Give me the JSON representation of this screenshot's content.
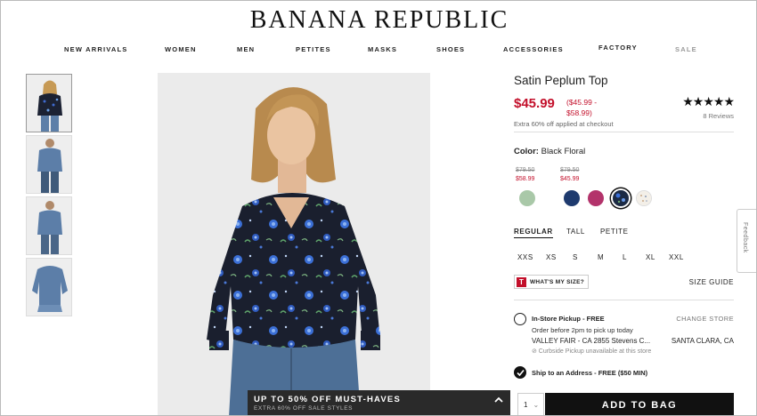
{
  "brand": {
    "logo": "BANANA REPUBLIC"
  },
  "nav": {
    "items": [
      "NEW ARRIVALS",
      "WOMEN",
      "MEN",
      "PETITES",
      "MASKS",
      "SHOES",
      "ACCESSORIES",
      "FACTORY",
      "SALE"
    ]
  },
  "promo": {
    "title": "UP TO 50% OFF MUST-HAVES",
    "subtitle": "EXTRA 60% OFF SALE STYLES"
  },
  "product": {
    "title": "Satin Peplum Top",
    "price": "$45.99",
    "range_line1": "($45.99 -",
    "range_line2": "$58.99)",
    "extra_note": "Extra 60% off applied at checkout",
    "stars": "★★★★★",
    "reviews": "8 Reviews",
    "color_label": "Color:",
    "color_value": "Black Floral",
    "swatch_prices": [
      {
        "was": "$79.50",
        "now": "$58.99"
      },
      {
        "was": "$79.50",
        "now": "$45.99"
      }
    ],
    "swatch_colors": [
      "#a9c8a8",
      "#1e3a6e",
      "#b3336b",
      "#1b2a44",
      "#f1ece6"
    ],
    "selected_swatch": 3
  },
  "fits": {
    "items": [
      "REGULAR",
      "TALL",
      "PETITE"
    ],
    "selected": 0
  },
  "sizes": {
    "items": [
      "XXS",
      "XS",
      "S",
      "M",
      "L",
      "XL",
      "XXL"
    ]
  },
  "size_tools": {
    "whats_my_size": "WHAT'S MY SIZE?",
    "whats_my_size_badge": "T",
    "size_guide": "SIZE GUIDE"
  },
  "fulfillment": {
    "pickup_label": "In-Store Pickup - FREE",
    "change_store": "CHANGE STORE",
    "pickup_note": "Order before 2pm to pick up today",
    "store_address": "VALLEY FAIR - CA 2855 Stevens C...",
    "store_city": "SANTA CLARA, CA",
    "curbside": "⊘ Curbside Pickup unavailable at this store",
    "ship_label": "Ship to an Address - FREE ($50 MIN)"
  },
  "cart": {
    "qty": "1",
    "qty_chevron": "⌄",
    "add_label": "ADD TO BAG"
  },
  "feedback": {
    "label": "Feedback"
  }
}
